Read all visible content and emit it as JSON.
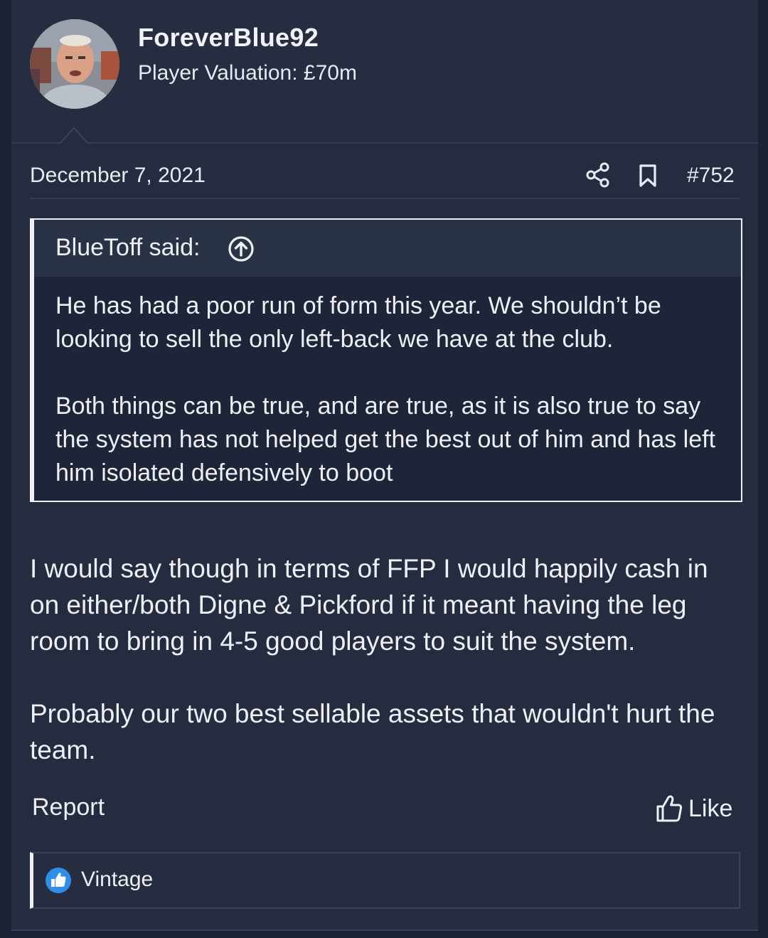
{
  "user": {
    "name": "ForeverBlue92",
    "title": "Player Valuation: £70m"
  },
  "post": {
    "date": "December 7, 2021",
    "number": "#752"
  },
  "quote": {
    "author_line": "BlueToff said:",
    "paragraphs": [
      "He has had a poor run of form this year. We shouldn’t be looking to sell the only left-back we have at the club.",
      "Both things can be true, and are true, as it is also true to say the system has not helped get the best out of him and has left him isolated defensively to boot"
    ]
  },
  "message": {
    "paragraphs": [
      "I would say though in terms of FFP I would happily cash in on either/both Digne & Pickford if it meant having the leg room to bring in 4-5 good players to suit the system.",
      "Probably our two best sellable assets that wouldn't hurt the team."
    ]
  },
  "actions": {
    "report_label": "Report",
    "like_label": "Like"
  },
  "reactions": {
    "users": "Vintage",
    "badge_color": "#2f8fe8"
  },
  "icons": {
    "share": "share-icon",
    "bookmark": "bookmark-icon",
    "quote_jump": "arrow-up-circle-icon",
    "like": "thumbs-up-icon",
    "reaction": "like-reaction-icon"
  }
}
